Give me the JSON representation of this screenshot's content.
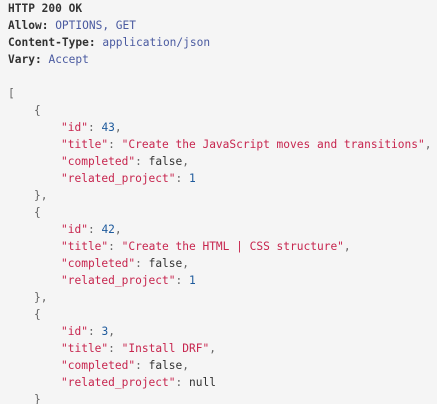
{
  "response": {
    "status_line": "HTTP 200 OK",
    "headers": [
      {
        "name": "Allow",
        "value": "OPTIONS, GET"
      },
      {
        "name": "Content-Type",
        "value": "application/json"
      },
      {
        "name": "Vary",
        "value": "Accept"
      }
    ]
  },
  "body": {
    "open_bracket": "[",
    "items": [
      {
        "id": "43",
        "title": "\"Create the JavaScript moves and transitions\"",
        "completed": "false",
        "related_project": "1"
      },
      {
        "id": "42",
        "title": "\"Create the HTML | CSS structure\"",
        "completed": "false",
        "related_project": "1"
      },
      {
        "id": "3",
        "title": "\"Install DRF\"",
        "completed": "false",
        "related_project": "null"
      }
    ],
    "keys": {
      "id": "\"id\"",
      "title": "\"title\"",
      "completed": "\"completed\"",
      "related_project": "\"related_project\""
    },
    "tokens": {
      "open_brace": "{",
      "close_brace_comma": "},",
      "close_brace": "}",
      "colon": ": ",
      "comma": ","
    }
  },
  "colors": {
    "background": "#f5f5f5",
    "key_string": "#c7254e",
    "number": "#1e5a9c",
    "header_value": "#4a5aa0"
  }
}
